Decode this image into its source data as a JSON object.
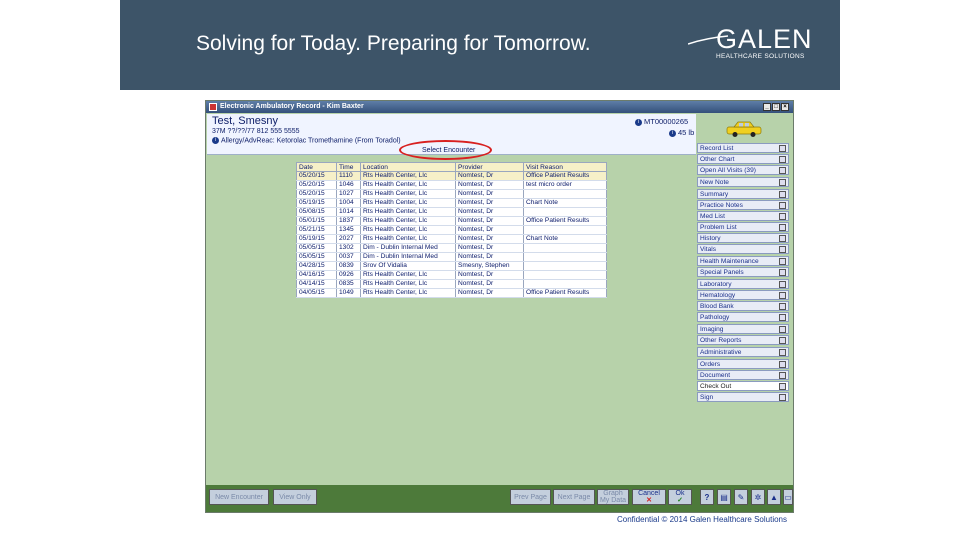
{
  "slide": {
    "tagline": "Solving for Today. Preparing for Tomorrow.",
    "logo_name": "GALEN",
    "logo_sub": "HEALTHCARE SOLUTIONS",
    "footer": "Confidential © 2014 Galen Healthcare Solutions",
    "banner_color": "#3d5468"
  },
  "window": {
    "title": "Electronic Ambulatory Record - Kim Baxter",
    "min_btn": "_",
    "max_btn": "□",
    "close_btn": "×"
  },
  "patient": {
    "name": "Test, Smesny",
    "info": "37M  ??/??/77  812 555 5555",
    "allergy": "Allergy/AdvReac: Ketorolac Tromethamine (From Toradol)",
    "mrn": "MT00000265",
    "weight": "45 lb"
  },
  "select_encounter": "Select Encounter",
  "encounter_table": {
    "headers": [
      "Date",
      "Time",
      "Location",
      "Provider",
      "Visit Reason"
    ],
    "rows": [
      [
        "05/20/15",
        "1110",
        "Rts Health Center, Llc",
        "Nomtest, Dr",
        "Office Patient Results"
      ],
      [
        "05/20/15",
        "1046",
        "Rts Health Center, Llc",
        "Nomtest, Dr",
        "test micro order"
      ],
      [
        "05/20/15",
        "1027",
        "Rts Health Center, Llc",
        "Nomtest, Dr",
        ""
      ],
      [
        "05/19/15",
        "1004",
        "Rts Health Center, Llc",
        "Nomtest, Dr",
        "Chart Note"
      ],
      [
        "05/08/15",
        "1014",
        "Rts Health Center, Llc",
        "Nomtest, Dr",
        ""
      ],
      [
        "05/01/15",
        "1837",
        "Rts Health Center, Llc",
        "Nomtest, Dr",
        "Office Patient Results"
      ],
      [
        "05/21/15",
        "1345",
        "Rts Health Center, Llc",
        "Nomtest, Dr",
        ""
      ],
      [
        "05/19/15",
        "2027",
        "Rts Health Center, Llc",
        "Nomtest, Dr",
        "Chart Note"
      ],
      [
        "05/05/15",
        "1302",
        "Dim - Dublin Internal Med",
        "Nomtest, Dr",
        ""
      ],
      [
        "05/05/15",
        "0037",
        "Dim - Dublin Internal Med",
        "Nomtest, Dr",
        ""
      ],
      [
        "04/28/15",
        "0839",
        "Srov Of Vidalia",
        "Smesny, Stephen",
        ""
      ],
      [
        "04/16/15",
        "0926",
        "Rts Health Center, Llc",
        "Nomtest, Dr",
        ""
      ],
      [
        "04/14/15",
        "0835",
        "Rts Health Center, Llc",
        "Nomtest, Dr",
        ""
      ],
      [
        "04/05/15",
        "1049",
        "Rts Health Center, Llc",
        "Nomtest, Dr",
        "Office Patient Results"
      ]
    ]
  },
  "sidebar": {
    "groups": [
      [
        "Record List",
        "Other Chart",
        "Open All Visits (39)"
      ],
      [
        "New Note"
      ],
      [
        "Summary",
        "Practice Notes",
        "Med List",
        "Problem List",
        "History",
        "Vitals"
      ],
      [
        "Health Maintenance",
        "Special Panels"
      ],
      [
        "Laboratory",
        "Hematology",
        "Blood Bank",
        "Pathology"
      ],
      [
        "Imaging",
        "Other Reports"
      ],
      [
        "Administrative"
      ],
      [
        "Orders",
        "Document",
        "Check Out",
        "Sign"
      ]
    ]
  },
  "bottom": {
    "new_encounter": "New Encounter",
    "view_only": "View Only",
    "prev_page": "Prev Page",
    "next_page": "Next Page",
    "graph": "Graph",
    "my_data": "My Data",
    "cancel": "Cancel",
    "ok": "Ok",
    "help": "?"
  }
}
